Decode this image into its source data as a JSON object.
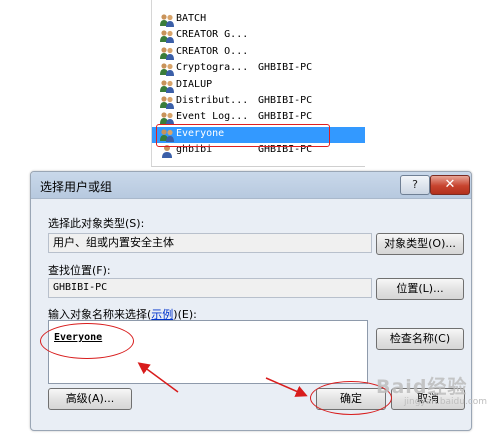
{
  "results_list": {
    "rows": [
      {
        "name": "BATCH",
        "folder": "",
        "icon": "group-icon"
      },
      {
        "name": "CREATOR G...",
        "folder": "",
        "icon": "group-icon"
      },
      {
        "name": "CREATOR O...",
        "folder": "",
        "icon": "group-icon"
      },
      {
        "name": "Cryptogra...",
        "folder": "GHBIBI-PC",
        "icon": "group-icon"
      },
      {
        "name": "DIALUP",
        "folder": "",
        "icon": "group-icon"
      },
      {
        "name": "Distribut...",
        "folder": "GHBIBI-PC",
        "icon": "group-icon"
      },
      {
        "name": "Event Log...",
        "folder": "GHBIBI-PC",
        "icon": "group-icon"
      },
      {
        "name": "Everyone",
        "folder": "",
        "icon": "group-icon",
        "selected": true
      },
      {
        "name": "ghbibi",
        "folder": "GHBIBI-PC",
        "icon": "user-icon"
      }
    ]
  },
  "dialog": {
    "title": "选择用户或组",
    "help_label": "?",
    "close_label": "✕",
    "object_type_label": "选择此对象类型(S):",
    "object_type_value": "用户、组或内置安全主体",
    "object_type_button": "对象类型(O)...",
    "location_label": "查找位置(F):",
    "location_value": "GHBIBI-PC",
    "location_button": "位置(L)...",
    "names_label_prefix": "输入对象名称来选择(",
    "names_label_link": "示例",
    "names_label_suffix": ")(E):",
    "names_value": "Everyone",
    "check_names_button": "检查名称(C)",
    "advanced_button": "高级(A)...",
    "ok_button": "确定",
    "cancel_button": "取消"
  },
  "watermark": {
    "text": "Baid经验",
    "sub": "jingyan.baidu.com"
  },
  "colors": {
    "selection": "#3399ff",
    "annotation_red": "#d81c1c",
    "dialog_bg": "#e9eef5"
  }
}
